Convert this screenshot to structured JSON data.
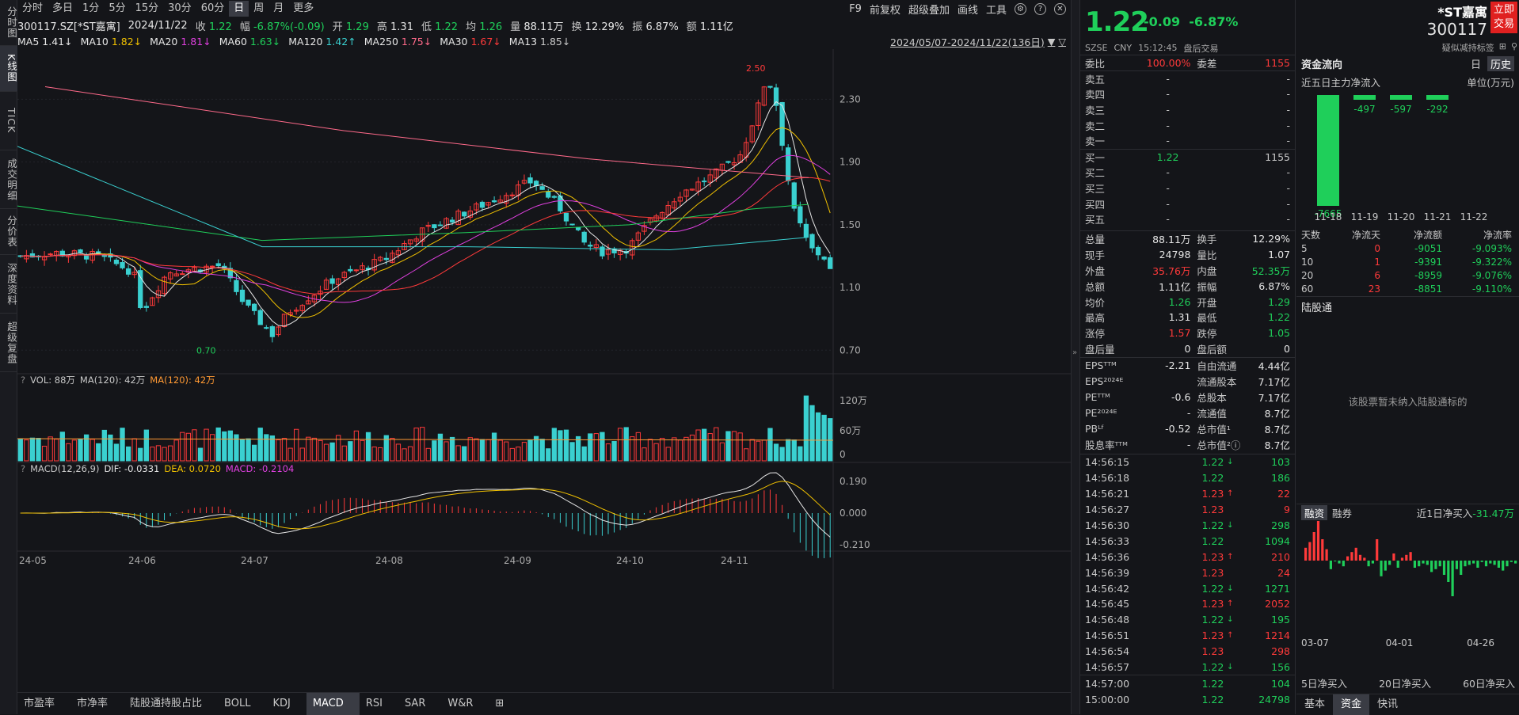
{
  "leftbar": [
    "分时图",
    "K线图",
    "TICK",
    "成交明细",
    "分价表",
    "深度资料",
    "超级复盘"
  ],
  "periods": [
    "分时",
    "多日",
    "1分",
    "5分",
    "15分",
    "30分",
    "60分",
    "日",
    "周",
    "月",
    "更多"
  ],
  "active_period": "日",
  "toolbar_right": [
    "F9",
    "前复权",
    "超级叠加",
    "画线",
    "工具"
  ],
  "quote": {
    "code": "300117.SZ[*ST嘉寓]",
    "date": "2024/11/22",
    "close_lbl": "收",
    "close": "1.22",
    "range_lbl": "幅",
    "range": "-6.87%(-0.09)",
    "open_lbl": "开",
    "open": "1.29",
    "high_lbl": "高",
    "high": "1.31",
    "low_lbl": "低",
    "low": "1.22",
    "avg_lbl": "均",
    "avg": "1.26",
    "vol_lbl": "量",
    "vol": "88.11万",
    "turn_lbl": "换",
    "turn": "12.29%",
    "amp_lbl": "振",
    "amp": "6.87%",
    "amt_lbl": "额",
    "amt": "1.11亿"
  },
  "ma": [
    {
      "l": "MA5",
      "v": "1.41↓",
      "c": "#e6e6e6"
    },
    {
      "l": "MA10",
      "v": "1.82↓",
      "c": "#f0c000"
    },
    {
      "l": "MA20",
      "v": "1.81↓",
      "c": "#e040e0"
    },
    {
      "l": "MA60",
      "v": "1.63↓",
      "c": "#1fcf5a"
    },
    {
      "l": "MA120",
      "v": "1.42↑",
      "c": "#3ad0d0"
    },
    {
      "l": "MA250",
      "v": "1.75↓",
      "c": "#ff6a8a"
    },
    {
      "l": "MA30",
      "v": "1.67↓",
      "c": "#ff3a3a"
    },
    {
      "l": "MA13",
      "v": "1.85↓",
      "c": "#c8c8c8"
    }
  ],
  "range_text": "2024/05/07-2024/11/22(136日)",
  "yaxis": [
    "2.30",
    "1.90",
    "1.50",
    "1.10",
    "0.70"
  ],
  "hi_label": "2.50",
  "lo_label": "0.70",
  "vol": {
    "q": "?",
    "title": "VOL: 88万",
    "ma": "MA(120): 42万",
    "ma2": "MA(120): 42万",
    "axis": [
      "120万",
      "60万",
      "0"
    ]
  },
  "macd": {
    "q": "?",
    "title": "MACD(12,26,9)",
    "dif": "DIF: -0.0331",
    "dea": "DEA: 0.0720",
    "macd": "MACD: -0.2104",
    "axis": [
      "0.190",
      "0.000",
      "-0.210"
    ]
  },
  "xaxis": [
    "24-05",
    "24-06",
    "24-07",
    "24-08",
    "24-09",
    "24-10",
    "24-11"
  ],
  "bottom_tabs": [
    "市盈率",
    "市净率",
    "陆股通持股占比",
    "BOLL",
    "KDJ",
    "MACD",
    "RSI",
    "SAR",
    "W&R",
    "⊞"
  ],
  "active_bottom": "MACD",
  "head": {
    "price": "1.22",
    "change": "-0.09",
    "pct": "-6.87%",
    "name": "*ST嘉寓",
    "code": "300117",
    "btn": "立即交易",
    "exch": "SZSE",
    "cur": "CNY",
    "time": "15:12:45",
    "status": "盘后交易",
    "note": "疑似减持标签"
  },
  "weibi": {
    "l1": "委比",
    "v1": "100.00%",
    "l2": "委差",
    "v2": "1155"
  },
  "sells": [
    {
      "n": "卖五",
      "p": "-",
      "v": "-"
    },
    {
      "n": "卖四",
      "p": "-",
      "v": "-"
    },
    {
      "n": "卖三",
      "p": "-",
      "v": "-"
    },
    {
      "n": "卖二",
      "p": "-",
      "v": "-"
    },
    {
      "n": "卖一",
      "p": "-",
      "v": "-"
    }
  ],
  "buys": [
    {
      "n": "买一",
      "p": "1.22",
      "v": "1155"
    },
    {
      "n": "买二",
      "p": "-",
      "v": "-"
    },
    {
      "n": "买三",
      "p": "-",
      "v": "-"
    },
    {
      "n": "买四",
      "p": "-",
      "v": "-"
    },
    {
      "n": "买五",
      "p": "-",
      "v": "-"
    }
  ],
  "stats": [
    [
      "总量",
      "88.11万",
      "换手",
      "12.29%"
    ],
    [
      "现手",
      "24798",
      "量比",
      "1.07"
    ],
    [
      "外盘",
      "35.76万",
      "内盘",
      "52.35万"
    ],
    [
      "总额",
      "1.11亿",
      "振幅",
      "6.87%"
    ],
    [
      "均价",
      "1.26",
      "开盘",
      "1.29"
    ],
    [
      "最高",
      "1.31",
      "最低",
      "1.22"
    ],
    [
      "涨停",
      "1.57",
      "跌停",
      "1.05"
    ],
    [
      "盘后量",
      "0",
      "盘后额",
      "0"
    ],
    [
      "EPSᵀᵀᴹ",
      "-2.21",
      "自由流通",
      "4.44亿"
    ],
    [
      "EPS²⁰²⁴ᴱ",
      "",
      "流通股本",
      "7.17亿"
    ],
    [
      "PEᵀᵀᴹ",
      "-0.6",
      "总股本",
      "7.17亿"
    ],
    [
      "PE²⁰²⁴ᴱ",
      "-",
      "流通值",
      "8.7亿"
    ],
    [
      "PBᴸᶠ",
      "-0.52",
      "总市值¹",
      "8.7亿"
    ],
    [
      "股息率ᵀᵀᴹ",
      "-",
      "总市值²ⓘ",
      "8.7亿"
    ]
  ],
  "ticks": [
    [
      "14:56:15",
      "1.22",
      "↓",
      "103",
      "g"
    ],
    [
      "14:56:18",
      "1.22",
      "",
      "186",
      "g"
    ],
    [
      "14:56:21",
      "1.23",
      "↑",
      "22",
      "r"
    ],
    [
      "14:56:27",
      "1.23",
      "",
      "9",
      "r"
    ],
    [
      "14:56:30",
      "1.22",
      "↓",
      "298",
      "g"
    ],
    [
      "14:56:33",
      "1.22",
      "",
      "1094",
      "g"
    ],
    [
      "14:56:36",
      "1.23",
      "↑",
      "210",
      "r"
    ],
    [
      "14:56:39",
      "1.23",
      "",
      "24",
      "r"
    ],
    [
      "14:56:42",
      "1.22",
      "↓",
      "1271",
      "g"
    ],
    [
      "14:56:45",
      "1.23",
      "↑",
      "2052",
      "r"
    ],
    [
      "14:56:48",
      "1.22",
      "↓",
      "195",
      "g"
    ],
    [
      "14:56:51",
      "1.23",
      "↑",
      "1214",
      "r"
    ],
    [
      "14:56:54",
      "1.23",
      "",
      "298",
      "r"
    ],
    [
      "14:56:57",
      "1.22",
      "↓",
      "156",
      "g"
    ],
    [
      "14:57:00",
      "1.22",
      "",
      "104",
      "g"
    ],
    [
      "15:00:00",
      "1.22",
      "",
      "24798",
      "g"
    ]
  ],
  "fund": {
    "title": "资金流向",
    "tabs": [
      "日",
      "历史"
    ],
    "active": "历史",
    "sub": "近五日主力净流入",
    "unit": "单位(万元)",
    "bars": [
      {
        "d": "11-18",
        "v": -7665
      },
      {
        "d": "11-19",
        "v": -497
      },
      {
        "d": "11-20",
        "v": -597
      },
      {
        "d": "11-21",
        "v": -292
      },
      {
        "d": "11-22",
        "v": 0
      }
    ],
    "labels": [
      "-7665",
      "-497",
      "-597",
      "-292"
    ],
    "table_head": [
      "天数",
      "净流天",
      "净流额",
      "净流率"
    ],
    "table": [
      [
        "5",
        "0",
        "-9051",
        "-9.093%"
      ],
      [
        "10",
        "1",
        "-9391",
        "-9.322%"
      ],
      [
        "20",
        "6",
        "-8959",
        "-9.076%"
      ],
      [
        "60",
        "23",
        "-8851",
        "-9.110%"
      ]
    ]
  },
  "hkconnect": {
    "title": "陆股通",
    "msg": "该股票暂未纳入陆股通标的"
  },
  "margin": {
    "tabs": [
      "融资",
      "融券"
    ],
    "active": "融资",
    "label": "近1日净买入",
    "value": "-31.47万",
    "dates": [
      "03-07",
      "04-01",
      "04-26"
    ],
    "foot": [
      "5日净买入",
      "20日净买入",
      "60日净买入"
    ]
  },
  "right_bottom_tabs": [
    "基本",
    "资金",
    "快讯"
  ],
  "right_bottom_active": "资金"
}
